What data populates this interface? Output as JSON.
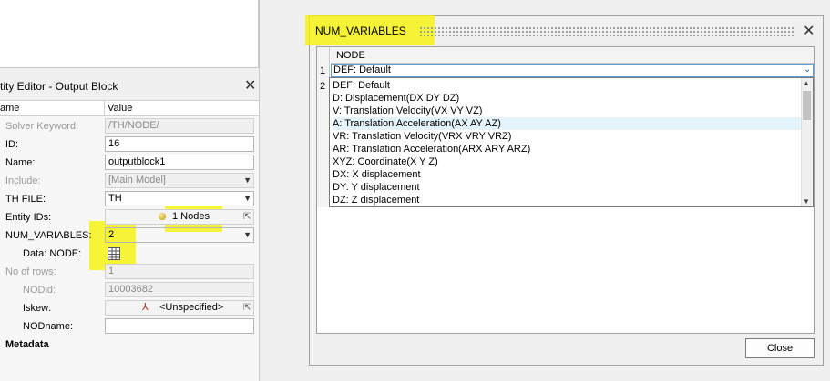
{
  "editor": {
    "title": "tity Editor - Output Block",
    "close_glyph": "✕",
    "columns": [
      "ame",
      "Value"
    ],
    "rows": [
      {
        "label": "Solver Keyword:",
        "value": "/TH/NODE/"
      },
      {
        "label": "ID:",
        "value": "16"
      },
      {
        "label": "Name:",
        "value": "outputblock1"
      },
      {
        "label": "Include:",
        "value": "[Main Model]"
      },
      {
        "label": "TH FILE:",
        "value": "TH"
      },
      {
        "label": "Entity IDs:",
        "value": "1 Nodes"
      },
      {
        "label": "NUM_VARIABLES:",
        "value": "2"
      },
      {
        "label": "Data: NODE:",
        "value": ""
      },
      {
        "label": "No of rows:",
        "value": "1"
      },
      {
        "label": "NODid:",
        "value": "10003682"
      },
      {
        "label": "Iskew:",
        "value": "<Unspecified>"
      },
      {
        "label": "NODname:",
        "value": ""
      }
    ],
    "metadata_label": "Metadata"
  },
  "dialog": {
    "title": "NUM_VARIABLES",
    "close_glyph": "✕",
    "column_header": "NODE",
    "row_indices": [
      "1",
      "2"
    ],
    "combo_value": "DEF: Default",
    "options": [
      "DEF: Default",
      "D: Displacement(DX DY DZ)",
      "V: Translation Velocity(VX VY VZ)",
      "A: Translation Acceleration(AX AY AZ)",
      "VR: Translation Velocity(VRX VRY VRZ)",
      "AR: Translation Acceleration(ARX ARY ARZ)",
      "XYZ: Coordinate(X Y Z)",
      "DX: X displacement",
      "DY: Y displacement",
      "DZ: Z displacement"
    ],
    "selected_option_index": 3,
    "close_button": "Close"
  },
  "colors": {
    "highlight": "#f6f300",
    "selection": "#e5f3fb",
    "combo_border": "#5d9ad8"
  }
}
